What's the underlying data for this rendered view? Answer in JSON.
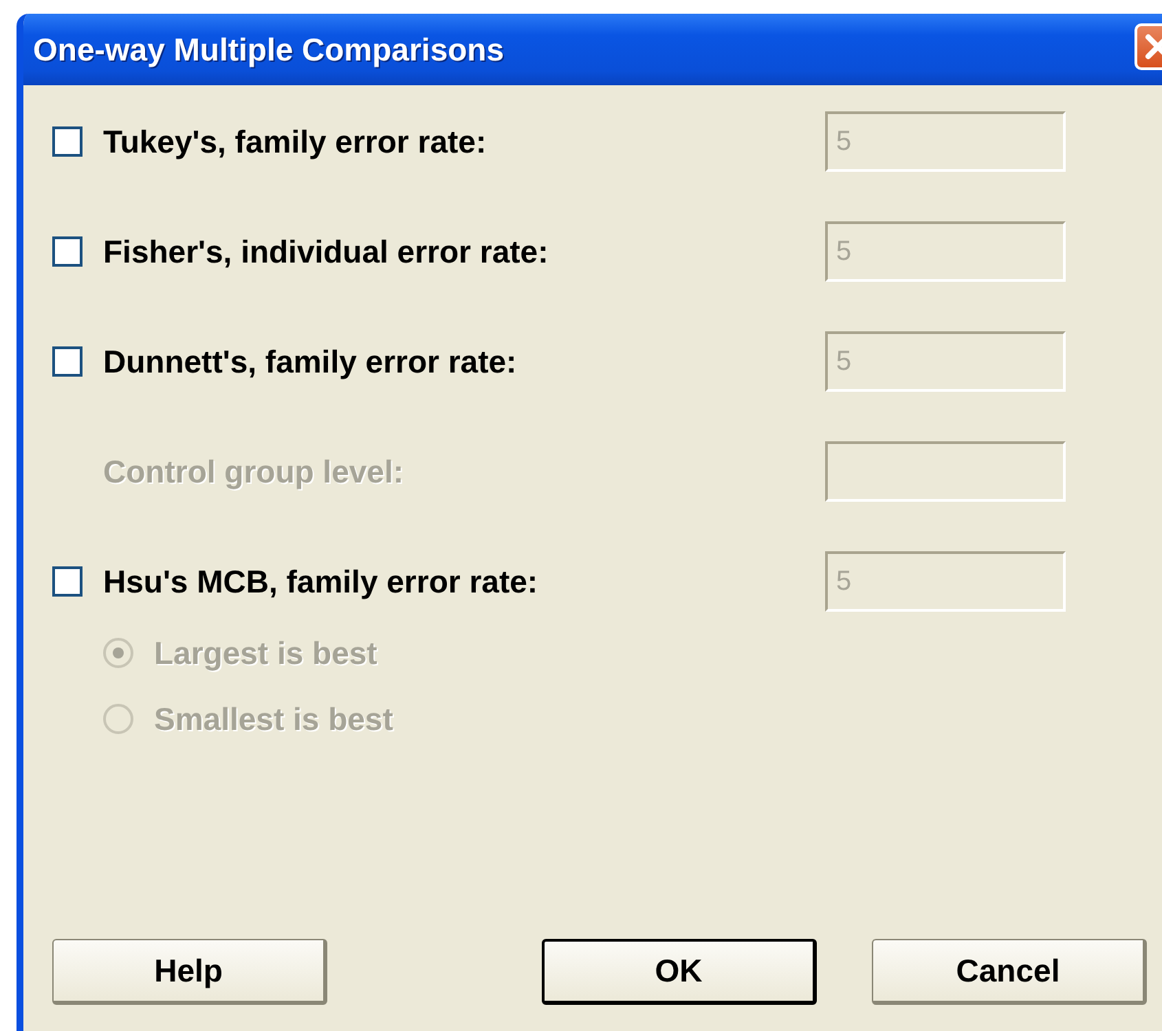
{
  "window": {
    "title": "One-way Multiple Comparisons"
  },
  "options": [
    {
      "kind": "checkbox",
      "label": "Tukey's, family error rate:",
      "checked": false,
      "disabled": false,
      "field": {
        "value": "5",
        "disabled": true
      }
    },
    {
      "kind": "checkbox",
      "label": "Fisher's, individual error rate:",
      "checked": false,
      "disabled": false,
      "field": {
        "value": "5",
        "disabled": true
      }
    },
    {
      "kind": "checkbox",
      "label": "Dunnett's, family error rate:",
      "checked": false,
      "disabled": false,
      "field": {
        "value": "5",
        "disabled": true
      }
    },
    {
      "kind": "label",
      "label": "Control group level:",
      "disabled": true,
      "field": {
        "disabled": true
      }
    },
    {
      "kind": "checkbox",
      "label": "Hsu's MCB, family error rate:",
      "checked": false,
      "disabled": false,
      "field": {
        "value": "5",
        "disabled": true
      }
    }
  ],
  "radios": [
    {
      "label": "Largest is best",
      "selected": true,
      "disabled": true
    },
    {
      "label": "Smallest is best",
      "selected": false,
      "disabled": true
    }
  ],
  "buttons": [
    {
      "label": "Help",
      "default": false
    },
    {
      "label": "OK",
      "default": true
    },
    {
      "label": "Cancel",
      "default": false
    }
  ]
}
